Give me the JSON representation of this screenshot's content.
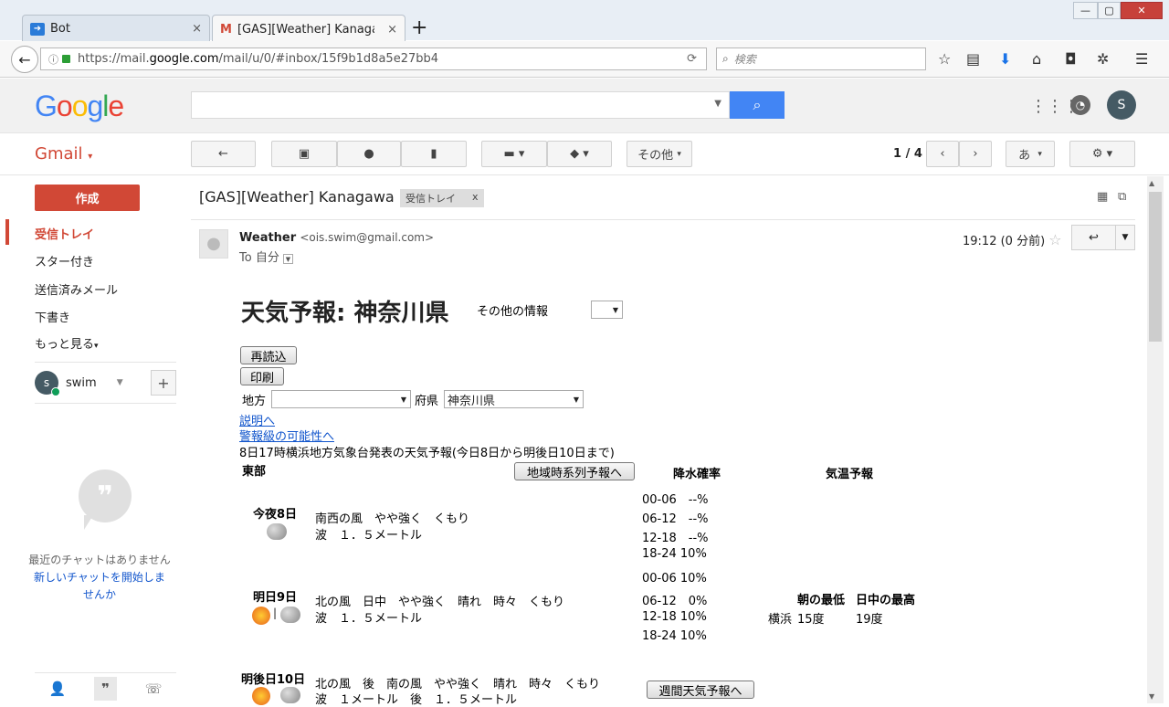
{
  "browser": {
    "tabs": [
      {
        "label": "Bot",
        "close": "×"
      },
      {
        "label": "[GAS][Weather] Kanagawa",
        "close": "×"
      }
    ],
    "new_tab": "+",
    "url_prefix": "https://mail.",
    "url_host": "google.com",
    "url_path": "/mail/u/0/#inbox/15f9b1d8a5e27bb4",
    "search_placeholder": "検索"
  },
  "google": {
    "logo": "Google",
    "avatar_letter": "S"
  },
  "gmail": {
    "label": "Gmail",
    "more_button": "その他",
    "pager": "1 / 4",
    "input_button": "あ"
  },
  "sidebar": {
    "compose": "作成",
    "items": [
      "受信トレイ",
      "スター付き",
      "送信済みメール",
      "下書き",
      "もっと見る"
    ],
    "user": "swim",
    "user_letter": "s",
    "chat_empty": "最近のチャットはありません",
    "chat_link": "新しいチャットを開始しませんか"
  },
  "message": {
    "subject": "[GAS][Weather] Kanagawa",
    "label": "受信トレイ",
    "label_close": "x",
    "sender_name": "Weather",
    "sender_email": "<ois.swim@gmail.com>",
    "to": "To 自分",
    "time": "19:12 (0 分前)"
  },
  "weather": {
    "title": "天気予報: 神奈川県",
    "other_info": "その他の情報",
    "reload": "再読込",
    "print": "印刷",
    "region_label": "地方",
    "pref_label": "府県",
    "pref_value": "神奈川県",
    "link_explain": "説明へ",
    "link_warning": "警報級の可能性へ",
    "announce": "8日17時横浜地方気象台発表の天気予報(今日8日から明後日10日まで)",
    "area": "東部",
    "timeseries_button": "地域時系列予報へ",
    "precip_header": "降水確率",
    "temp_header": "気温予報",
    "days": [
      {
        "name": "今夜8日",
        "line1": "南西の風　やや強く　くもり",
        "line2": "波　１．５メートル",
        "precip": [
          "00-06　--%",
          "06-12　--%",
          "12-18　--%",
          "18-24 10%"
        ]
      },
      {
        "name": "明日9日",
        "line1": "北の風　日中　やや強く　晴れ　時々　くもり",
        "line2": "波　１．５メートル",
        "precip": [
          "00-06 10%",
          "06-12　0%",
          "12-18 10%",
          "18-24 10%"
        ]
      },
      {
        "name": "明後日10日",
        "line1": "北の風　後　南の風　やや強く　晴れ　時々　くもり",
        "line2": "波　１メートル　後　１．５メートル"
      }
    ],
    "temp": {
      "low_header": "朝の最低",
      "high_header": "日中の最高",
      "city": "横浜",
      "low": "15度",
      "high": "19度"
    },
    "weekly_button": "週間天気予報へ"
  }
}
